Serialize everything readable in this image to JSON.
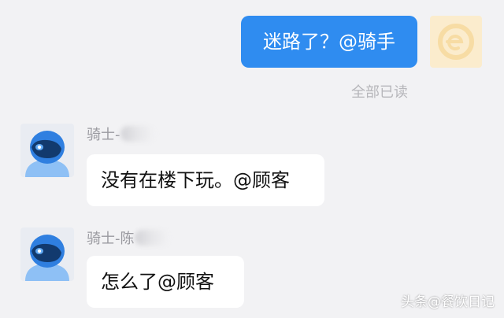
{
  "chat": {
    "outgoing": {
      "text": "迷路了？@骑手",
      "status": "全部已读",
      "avatar_icon": "shop-logo-icon"
    },
    "incoming": [
      {
        "sender": "骑士-",
        "sender_blurred": true,
        "text": "没有在楼下玩。@顾客",
        "avatar_icon": "rider-helmet-icon"
      },
      {
        "sender": "骑士-陈",
        "sender_blurred": true,
        "text": "怎么了@顾客",
        "avatar_icon": "rider-helmet-icon"
      }
    ]
  },
  "watermark": "头条@餐饮日记",
  "colors": {
    "background": "#f2f2f4",
    "outgoing_bubble": "#2f8cf0",
    "incoming_bubble": "#ffffff",
    "helmet": "#2f7fe0"
  }
}
